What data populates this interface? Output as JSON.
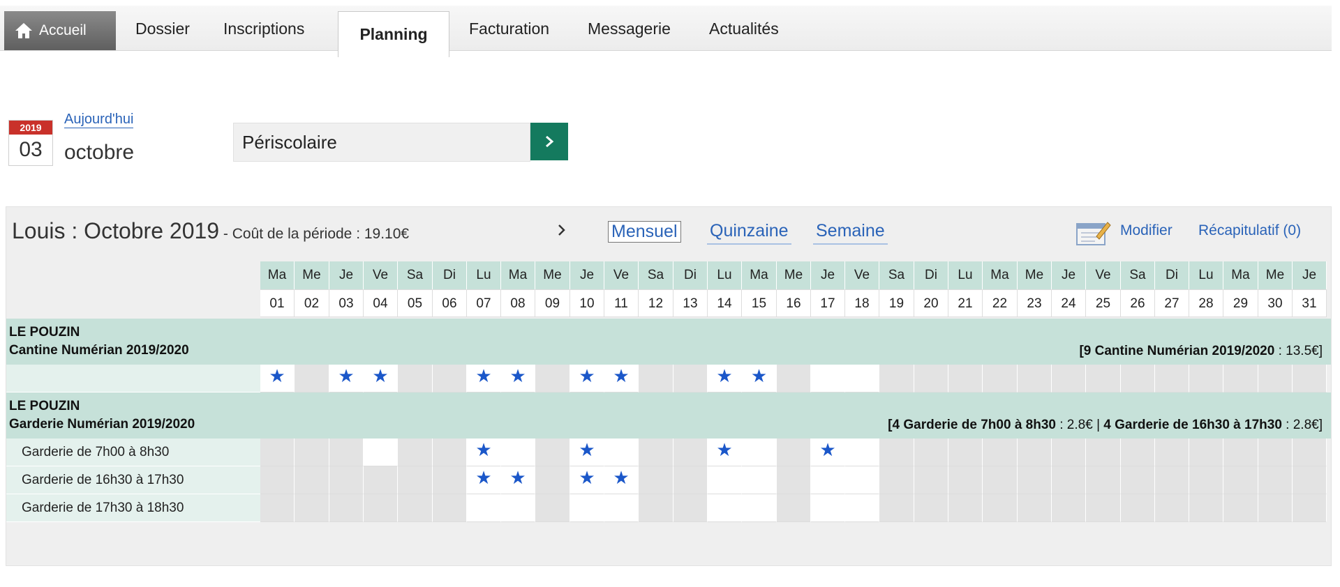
{
  "nav": {
    "home": "Accueil",
    "tabs": [
      {
        "id": "dossier",
        "label": "Dossier"
      },
      {
        "id": "inscriptions",
        "label": "Inscriptions"
      },
      {
        "id": "planning",
        "label": "Planning"
      },
      {
        "id": "facturation",
        "label": "Facturation"
      },
      {
        "id": "messagerie",
        "label": "Messagerie"
      },
      {
        "id": "actualites",
        "label": "Actualités"
      }
    ]
  },
  "date_picker": {
    "year": "2019",
    "day": "03",
    "month": "octobre",
    "today_link": "Aujourd'hui"
  },
  "activity_select": {
    "value": "Périscolaire",
    "go_icon": "chevron-right-icon"
  },
  "planning": {
    "title": "Louis : Octobre 2019",
    "cost_text": " - Coût de la période : 19.10€",
    "next_icon": "chevron-right-icon",
    "views": {
      "monthly": "Mensuel",
      "fortnight": "Quinzaine",
      "week": "Semaine"
    },
    "active_view": "monthly",
    "modify_icon": "edit-calendar-icon",
    "modify": "Modifier",
    "summary": "Récapitulatif (0)",
    "day_names": [
      "Ma",
      "Me",
      "Je",
      "Ve",
      "Sa",
      "Di",
      "Lu",
      "Ma",
      "Me",
      "Je",
      "Ve",
      "Sa",
      "Di",
      "Lu",
      "Ma",
      "Me",
      "Je",
      "Ve",
      "Sa",
      "Di",
      "Lu",
      "Ma",
      "Me",
      "Je",
      "Ve",
      "Sa",
      "Di",
      "Lu",
      "Ma",
      "Me",
      "Je"
    ],
    "dates": [
      "01",
      "02",
      "03",
      "04",
      "05",
      "06",
      "07",
      "08",
      "09",
      "10",
      "11",
      "12",
      "13",
      "14",
      "15",
      "16",
      "17",
      "18",
      "19",
      "20",
      "21",
      "22",
      "23",
      "24",
      "25",
      "26",
      "27",
      "28",
      "29",
      "30",
      "31"
    ],
    "groups": [
      {
        "place": "LE POUZIN",
        "name": "Cantine Numérian 2019/2020",
        "summary_bold": "[9 Cantine Numérian 2019/2020",
        "summary_rest": " : 13.5€]",
        "rows": [
          {
            "label": "",
            "open": [
              1,
              3,
              4,
              7,
              8,
              10,
              11,
              14,
              15,
              17,
              18
            ],
            "booked": [
              1,
              3,
              4,
              7,
              8,
              10,
              11,
              14,
              15
            ]
          }
        ]
      },
      {
        "place": "LE POUZIN",
        "name": "Garderie Numérian 2019/2020",
        "summary_bold": "[4 Garderie de 7h00 à 8h30",
        "summary_mid": " : 2.8€ | ",
        "summary_bold2": "4 Garderie de 16h30 à 17h30",
        "summary_rest": " : 2.8€]",
        "rows": [
          {
            "label": "Garderie de 7h00 à 8h30",
            "open": [
              4,
              7,
              8,
              10,
              11,
              14,
              15,
              17,
              18
            ],
            "booked": [
              7,
              10,
              14,
              17
            ]
          },
          {
            "label": "Garderie de 16h30 à 17h30",
            "open": [
              7,
              8,
              10,
              11,
              14,
              15,
              17,
              18
            ],
            "booked": [
              7,
              8,
              10,
              11
            ]
          },
          {
            "label": "Garderie de 17h30 à 18h30",
            "open": [
              7,
              8,
              10,
              11,
              14,
              15,
              17,
              18
            ],
            "booked": []
          }
        ]
      }
    ],
    "star_icon": "star-icon"
  }
}
